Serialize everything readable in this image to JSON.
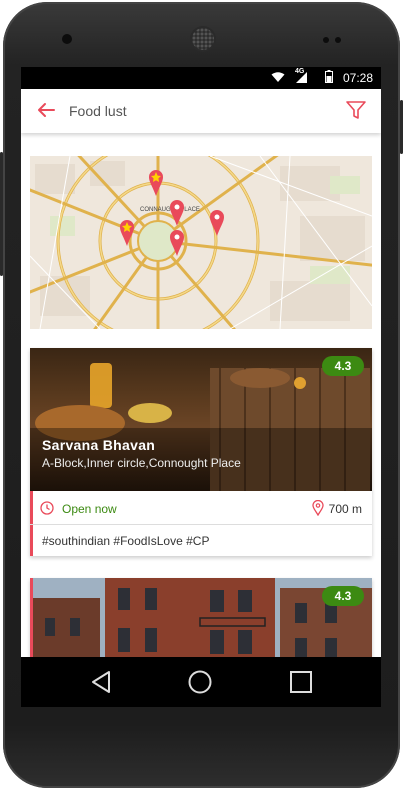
{
  "status_bar": {
    "time": "07:28",
    "network": "4G"
  },
  "app_bar": {
    "title": "Food lust",
    "back_icon": "back-arrow-icon",
    "filter_icon": "filter-icon"
  },
  "colors": {
    "accent": "#e94a5a",
    "rating_bg": "#3c8a12",
    "open_green": "#3c8a12"
  },
  "map": {
    "label": "CONNAUGHT PLACE"
  },
  "restaurants": [
    {
      "name": "Sarvana Bhavan",
      "address": "A-Block,Inner circle,Connought Place",
      "rating": "4.3",
      "status": "Open now",
      "distance": "700 m",
      "tags": "#southindian #FoodIsLove #CP"
    },
    {
      "rating": "4.3"
    }
  ]
}
